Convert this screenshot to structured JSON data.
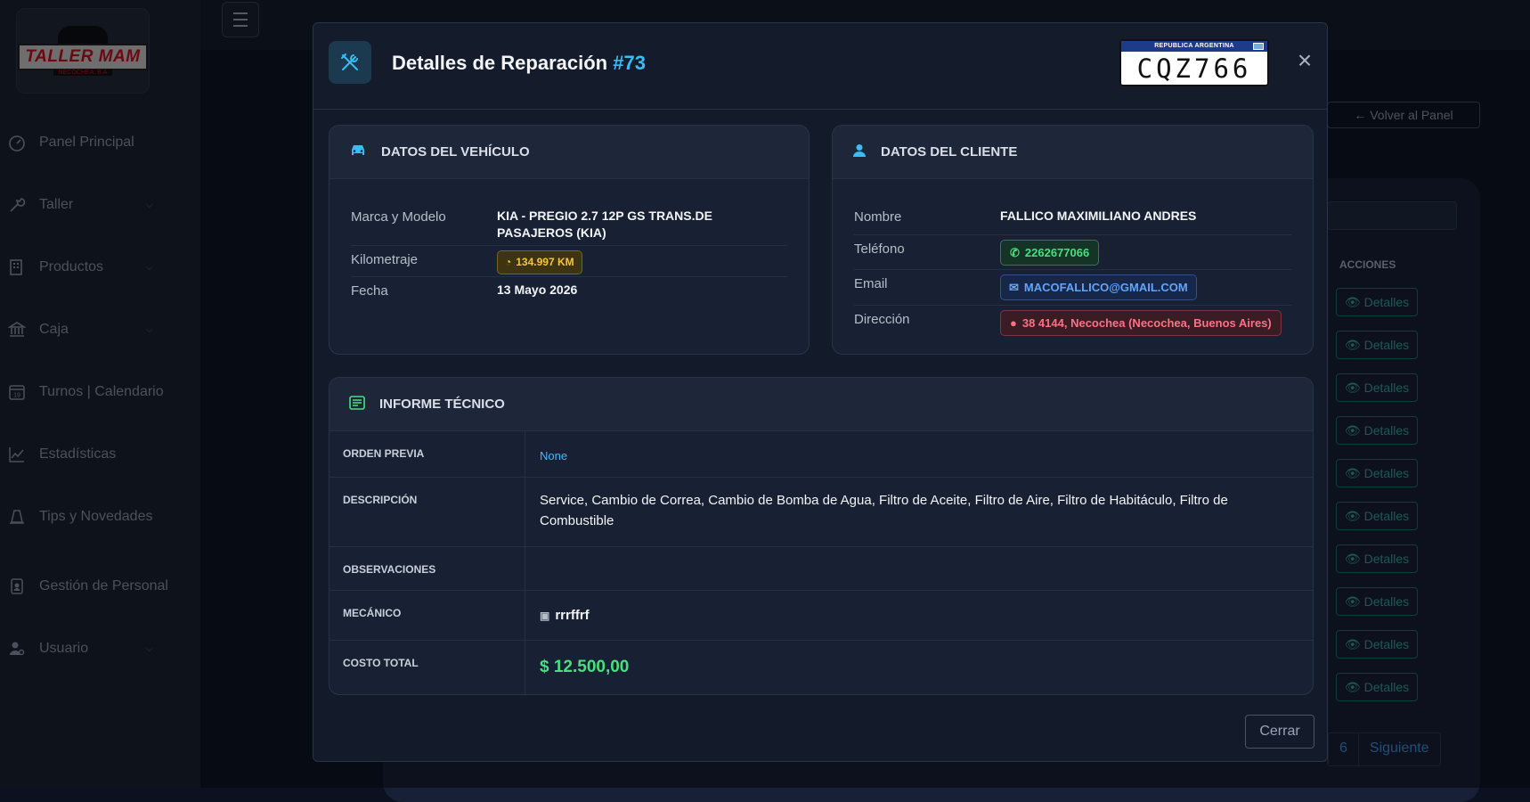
{
  "sidebar": {
    "logo": {
      "name": "TALLER MAM",
      "sub": "NECOCHEA, B.A"
    },
    "items": [
      {
        "label": "Panel Principal",
        "icon": "gauge-icon"
      },
      {
        "label": "Taller",
        "icon": "wrench-icon",
        "expandable": true
      },
      {
        "label": "Productos",
        "icon": "building-icon",
        "expandable": true
      },
      {
        "label": "Caja",
        "icon": "bank-icon",
        "expandable": true
      },
      {
        "label": "Turnos | Calendario",
        "icon": "calendar-icon"
      },
      {
        "label": "Estadísticas",
        "icon": "chart-line-icon"
      },
      {
        "label": "Tips y Novedades",
        "icon": "cone-icon"
      },
      {
        "label": "Gestión de Personal",
        "icon": "id-badge-icon"
      },
      {
        "label": "Usuario",
        "icon": "user-gear-icon",
        "expandable": true
      }
    ],
    "calendar_day": "19"
  },
  "background": {
    "back_button": "← Volver al Panel",
    "table_header_actions": "ACCIONES",
    "row_button": "Detalles",
    "pagination": {
      "page": "6",
      "next": "Siguiente"
    }
  },
  "modal": {
    "title": "Detalles de Reparación",
    "number": "#73",
    "plate": {
      "country": "REPUBLICA ARGENTINA",
      "number": "CQZ766"
    },
    "vehicle": {
      "header": "DATOS DEL VEHÍCULO",
      "brand_label": "Marca y Modelo",
      "brand_value": "KIA - PREGIO 2.7 12P GS TRANS.DE PASAJEROS (KIA)",
      "km_label": "Kilometraje",
      "km_value": "134.997 KM",
      "date_label": "Fecha",
      "date_value": "13 Mayo 2026"
    },
    "client": {
      "header": "DATOS DEL CLIENTE",
      "name_label": "Nombre",
      "name_value": "FALLICO MAXIMILIANO ANDRES",
      "phone_label": "Teléfono",
      "phone_value": "2262677066",
      "email_label": "Email",
      "email_value": "MACOFALLICO@GMAIL.COM",
      "address_label": "Dirección",
      "address_value": "38 4144, Necochea (Necochea, Buenos Aires)"
    },
    "report": {
      "header": "INFORME TÉCNICO",
      "prev_order_label": "ORDEN PREVIA",
      "prev_order_value": "None",
      "description_label": "DESCRIPCIÓN",
      "description_value": "Service, Cambio de Correa, Cambio de Bomba de Agua, Filtro de Aceite, Filtro de Aire, Filtro de Habitáculo, Filtro de Combustible",
      "observations_label": "OBSERVACIONES",
      "observations_value": "",
      "mechanic_label": "MECÁNICO",
      "mechanic_value": "rrrffrf",
      "cost_label": "COSTO TOTAL",
      "cost_value": "$ 12.500,00"
    },
    "close_button": "Cerrar"
  }
}
